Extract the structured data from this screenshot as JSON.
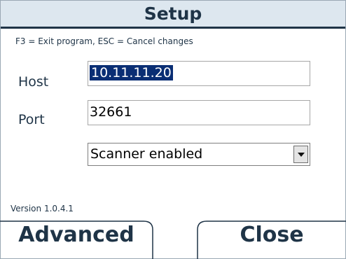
{
  "window": {
    "title": "Setup"
  },
  "hint": "F3 = Exit program, ESC = Cancel changes",
  "fields": {
    "host": {
      "label": "Host",
      "value": "10.11.11.20"
    },
    "port": {
      "label": "Port",
      "value": "32661"
    }
  },
  "scanner": {
    "selected": "Scanner enabled"
  },
  "version": "Version 1.0.4.1",
  "softkeys": {
    "left": "Advanced",
    "right": "Close"
  },
  "colors": {
    "text": "#1f3447",
    "title_bg": "#dde7ef",
    "selection": "#0a2e74"
  }
}
